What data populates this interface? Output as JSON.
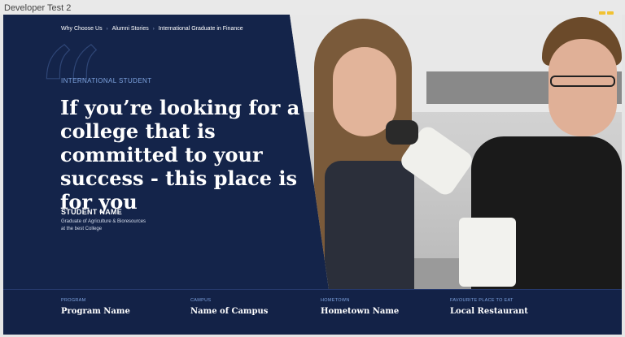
{
  "window": {
    "title": "Developer Test 2"
  },
  "breadcrumb": [
    "Why Choose Us",
    "Alumni Stories",
    "International Graduate in Finance"
  ],
  "hero": {
    "eyebrow": "INTERNATIONAL STUDENT",
    "quote": "If you’re looking for a college that is committed to your success - this place is for you",
    "student_name": "STUDENT NAME",
    "student_desc_line1": "Graduate of Agriculture & Bioresources",
    "student_desc_line2": "at the best College",
    "image_description": "photo-of-students-with-microscope"
  },
  "info": [
    {
      "label": "PROGRAM",
      "value": "Program Name"
    },
    {
      "label": "CAMPUS",
      "value": "Name of Campus"
    },
    {
      "label": "HOMETOWN",
      "value": "Hometown Name"
    },
    {
      "label": "FAVOURITE PLACE TO EAT",
      "value": "Local Restaurant"
    }
  ],
  "colors": {
    "navy": "#14244a",
    "accent": "#7ea3df"
  }
}
